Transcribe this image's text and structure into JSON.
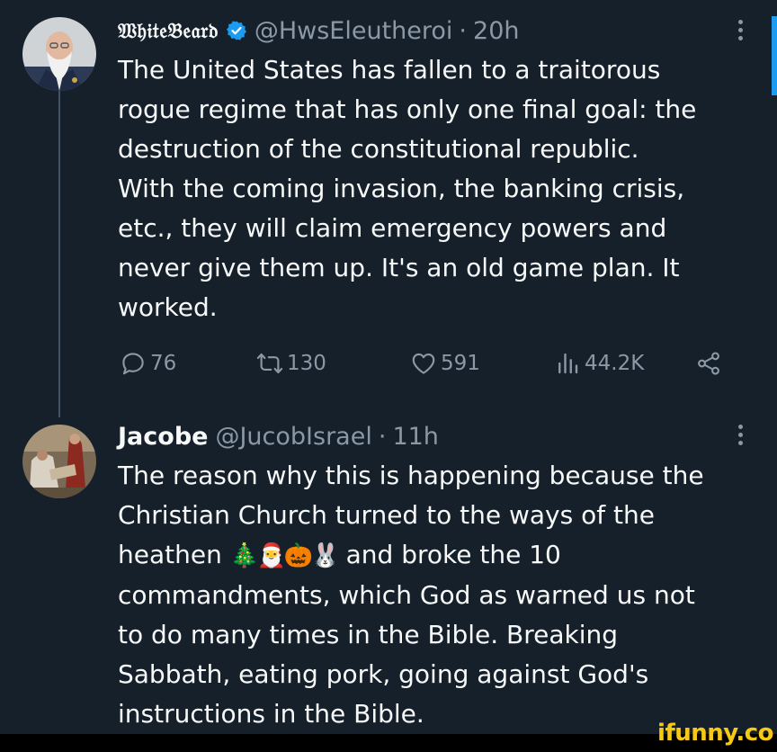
{
  "tweet1": {
    "display_name": "𝔚𝔥𝔦𝔱𝔢𝔅𝔢𝔞𝔯𝔡",
    "handle": "@HwsEleutheroi",
    "separator": "·",
    "time": "20h",
    "lines": [
      "The United States has fallen to a traitorous",
      "rogue regime that has only one final goal: the",
      "destruction of the constitutional republic.",
      "With the coming invasion, the banking crisis,",
      "etc., they will claim emergency powers and",
      "never give them up. It's an old game plan. It",
      "worked."
    ],
    "stats": {
      "replies": "76",
      "retweets": "130",
      "likes": "591",
      "views": "44.2K"
    }
  },
  "tweet2": {
    "display_name": "Jacobe",
    "handle": "@JucobIsrael",
    "separator": "·",
    "time": "11h",
    "line1": "The reason why this is happening because the",
    "line2": "Christian Church turned to the ways of the",
    "line3_start": "heathen",
    "emojis": [
      "🎄",
      "🎅",
      "🎃",
      "🐰"
    ],
    "line3_end": "and broke the 10",
    "line4": "commandments, which God as warned us not",
    "line5": "to do many times in the Bible. Breaking",
    "line6": "Sabbath, eating pork, going against God's",
    "line7": "instructions in the Bible."
  },
  "watermark": "ifunny.co",
  "colors": {
    "background": "#15202b",
    "text": "#f7f9f9",
    "muted": "#8b98a5",
    "verified": "#1d9bf0",
    "watermark": "#f6c915"
  },
  "icons": [
    "verified-badge-icon",
    "more-icon",
    "reply-icon",
    "retweet-icon",
    "like-icon",
    "views-icon",
    "share-icon"
  ]
}
